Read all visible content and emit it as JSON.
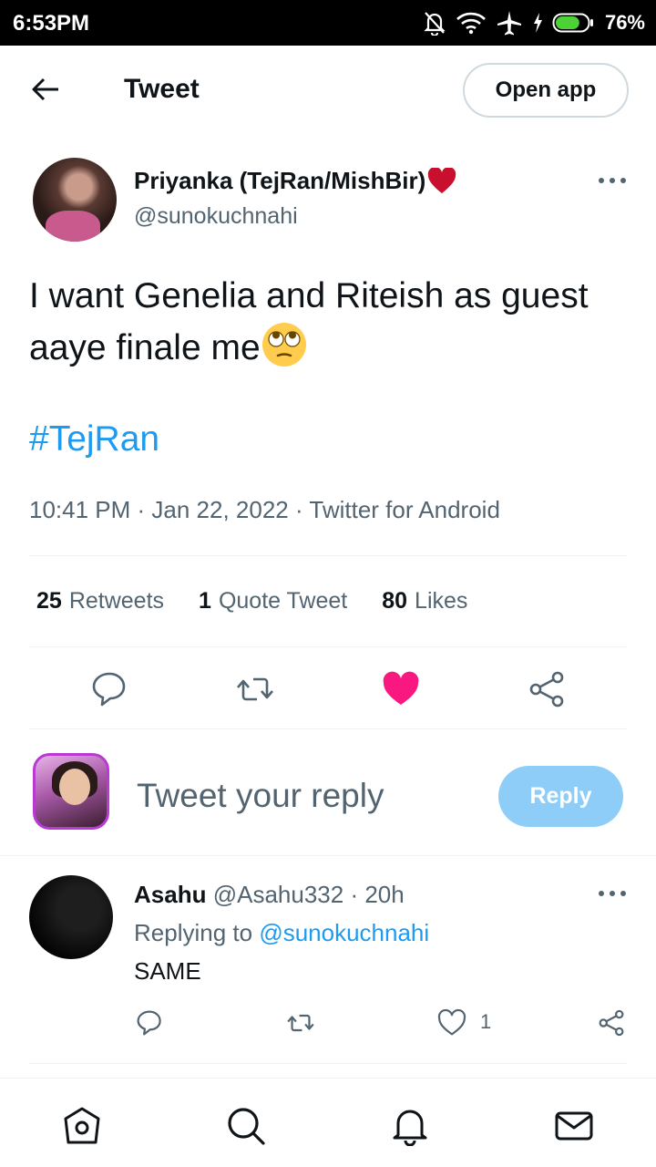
{
  "status_bar": {
    "time": "6:53PM",
    "battery_percent": "76%",
    "battery_level": 0.76,
    "icons": [
      "mute-bell-icon",
      "wifi-icon",
      "airplane-icon",
      "charging-icon",
      "battery-icon"
    ]
  },
  "nav": {
    "title": "Tweet",
    "open_app_label": "Open app"
  },
  "tweet": {
    "author_name": "Priyanka (TejRan/MishBir)",
    "author_handle": "@sunokuchnahi",
    "text": "I want Genelia and Riteish as guest aaye finale me",
    "hashtag": "#TejRan",
    "meta": "10:41 PM · Jan 22, 2022 · Twitter for Android",
    "stats": [
      {
        "count": "25",
        "label": "Retweets"
      },
      {
        "count": "1",
        "label": "Quote Tweet"
      },
      {
        "count": "80",
        "label": "Likes"
      }
    ],
    "liked": true
  },
  "composer": {
    "placeholder": "Tweet your reply",
    "reply_label": "Reply"
  },
  "reply": {
    "name": "Asahu",
    "handle": "@Asahu332",
    "time": "· 20h",
    "replying_prefix": "Replying to",
    "replying_to": "@sunokuchnahi",
    "text": "SAME",
    "like_count": "1"
  },
  "colors": {
    "accent": "#1d9bf0",
    "like": "#f91880",
    "reply_button": "#8ecdf8",
    "secondary_text": "#536471"
  }
}
